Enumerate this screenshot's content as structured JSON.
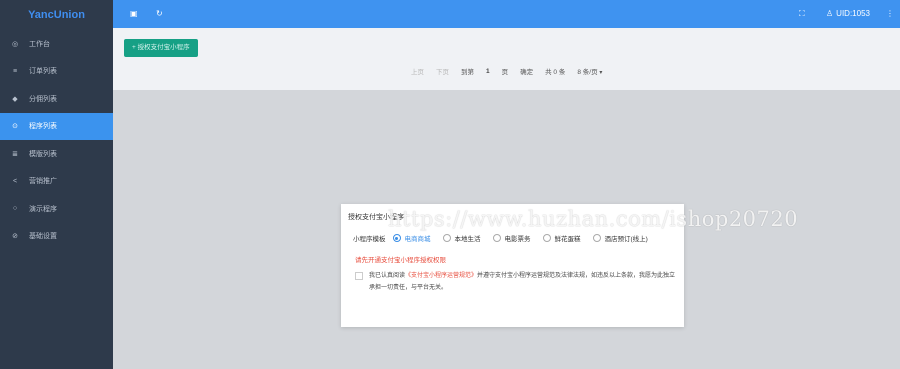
{
  "app": {
    "brand": "YancUnion"
  },
  "sidebar": {
    "items": [
      {
        "label": "工作台",
        "icon": "dashboard-icon",
        "glyph": "◎",
        "active": false
      },
      {
        "label": "订单列表",
        "icon": "list-icon",
        "glyph": "≡",
        "active": false
      },
      {
        "label": "分佣列表",
        "icon": "diamond-icon",
        "glyph": "◆",
        "active": false
      },
      {
        "label": "程序列表",
        "icon": "program-icon",
        "glyph": "⊙",
        "active": true
      },
      {
        "label": "模版列表",
        "icon": "template-icon",
        "glyph": "≣",
        "active": false
      },
      {
        "label": "营销推广",
        "icon": "share-icon",
        "glyph": "<",
        "active": false
      },
      {
        "label": "演示程序",
        "icon": "demo-icon",
        "glyph": "○",
        "active": false
      },
      {
        "label": "基础设置",
        "icon": "settings-icon",
        "glyph": "⊘",
        "active": false
      }
    ]
  },
  "header": {
    "menu_icon": "▣",
    "refresh_icon": "↻",
    "fullscreen_icon": "⛶",
    "user_icon": "♙",
    "uid": "UID:1053",
    "more_icon": "⋮"
  },
  "main": {
    "add_button": "+ 授权支付宝小程序",
    "pager": {
      "first": "上页",
      "prev": "下页",
      "goto": "到第",
      "page": "1",
      "page_unit": "页",
      "confirm": "确定",
      "total": "共 0 条",
      "per_page": "8 条/页",
      "caret": "▾"
    }
  },
  "modal": {
    "title": "授权支付宝小程序",
    "template_label": "小程序模板",
    "options": [
      {
        "label": "电商商城",
        "selected": true
      },
      {
        "label": "本地生活",
        "selected": false
      },
      {
        "label": "电影票务",
        "selected": false
      },
      {
        "label": "鲜花蛋糕",
        "selected": false
      },
      {
        "label": "酒店预订(线上)",
        "selected": false
      }
    ],
    "notice": "请先开通支付宝小程序授权权限",
    "agreement_prefix": "我已认真阅读",
    "agreement_link": "《支付宝小程序运营规范》",
    "agreement_suffix": "并遵守支付宝小程序运营规范及法律法规，如违反以上条款，我愿为此独立承担一切责任，与平台无关。"
  },
  "watermark": "https://www.huzhan.com/ishop20720"
}
